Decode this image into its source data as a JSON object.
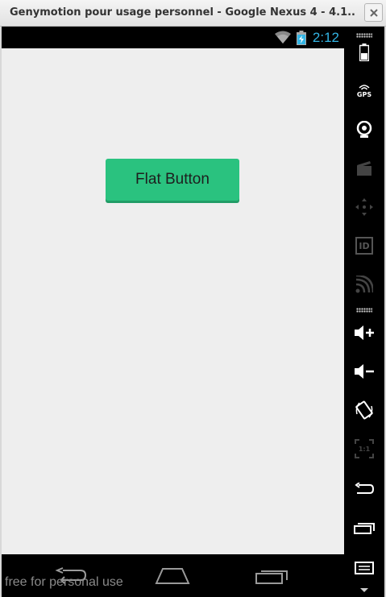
{
  "window": {
    "title": "Genymotion pour usage personnel - Google Nexus 4 - 4.1...."
  },
  "statusbar": {
    "time": "2:12",
    "icons": [
      "wifi-icon",
      "battery-charging-icon"
    ]
  },
  "screen": {
    "button_label": "Flat Button",
    "button_color": "#2ac27f",
    "background_color": "#eeeeee"
  },
  "navbar": {
    "icons": [
      "back-icon",
      "home-icon",
      "recent-apps-icon"
    ],
    "watermark": "free for personal use"
  },
  "sidebar": {
    "items": [
      {
        "name": "battery-widget-icon",
        "enabled": true
      },
      {
        "name": "gps-widget-icon",
        "label": "GPS",
        "enabled": true
      },
      {
        "name": "camera-widget-icon",
        "enabled": true
      },
      {
        "name": "screencast-icon",
        "enabled": false
      },
      {
        "name": "dpad-icon",
        "enabled": false
      },
      {
        "name": "device-id-icon",
        "label": "ID",
        "enabled": false
      },
      {
        "name": "network-rss-icon",
        "enabled": false
      },
      {
        "name": "volume-up-icon",
        "enabled": true
      },
      {
        "name": "volume-down-icon",
        "enabled": true
      },
      {
        "name": "rotate-icon",
        "enabled": true
      },
      {
        "name": "scale-icon",
        "label": "1:1",
        "enabled": false
      },
      {
        "name": "back-button-icon",
        "enabled": true
      },
      {
        "name": "recent-button-icon",
        "enabled": true
      },
      {
        "name": "menu-button-icon",
        "enabled": true
      }
    ],
    "accent_color": "#33b5e5"
  }
}
